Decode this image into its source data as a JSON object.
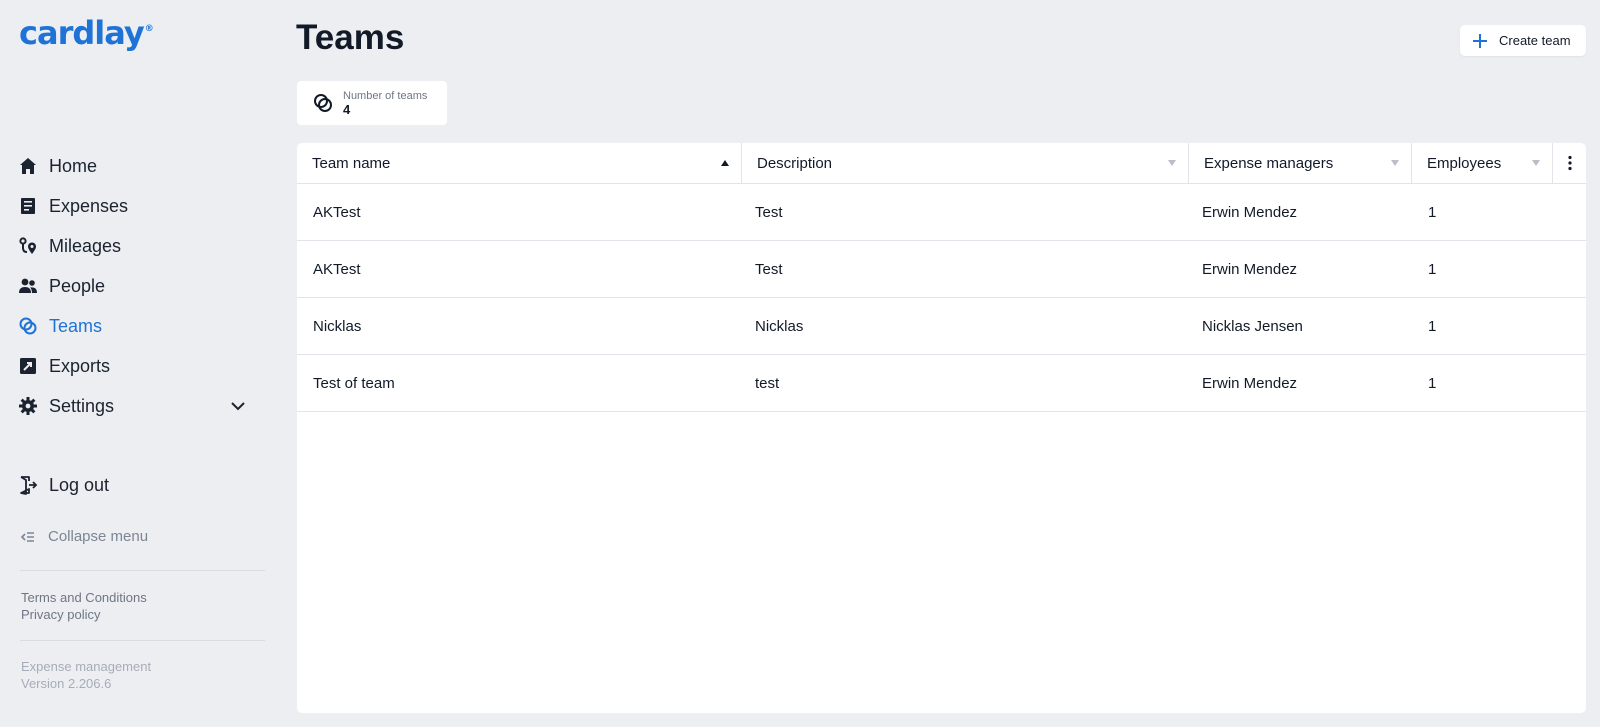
{
  "app": {
    "logo_text": "cardlay",
    "logo_mark": "®",
    "brand_color": "#1f73d6"
  },
  "sidebar": {
    "items": [
      {
        "label": "Home",
        "icon": "home-icon"
      },
      {
        "label": "Expenses",
        "icon": "receipt-icon"
      },
      {
        "label": "Mileages",
        "icon": "route-pin-icon"
      },
      {
        "label": "People",
        "icon": "people-icon"
      },
      {
        "label": "Teams",
        "icon": "teams-icon",
        "active": true
      },
      {
        "label": "Exports",
        "icon": "export-icon"
      },
      {
        "label": "Settings",
        "icon": "gear-icon"
      }
    ],
    "logout_label": "Log out",
    "collapse_label": "Collapse menu",
    "terms_label": "Terms and Conditions",
    "privacy_label": "Privacy policy",
    "product_name": "Expense management",
    "version": "Version 2.206.6"
  },
  "main": {
    "title": "Teams",
    "create_button_label": "Create team",
    "stat": {
      "label": "Number of teams",
      "value": "4"
    },
    "table": {
      "columns": [
        "Team name",
        "Description",
        "Expense managers",
        "Employees"
      ],
      "rows": [
        [
          "AKTest",
          "Test",
          "Erwin Mendez",
          "1"
        ],
        [
          "AKTest",
          "Test",
          "Erwin Mendez",
          "1"
        ],
        [
          "Nicklas",
          "Nicklas",
          "Nicklas Jensen",
          "1"
        ],
        [
          "Test of team",
          "test",
          "Erwin Mendez",
          "1"
        ]
      ]
    }
  }
}
